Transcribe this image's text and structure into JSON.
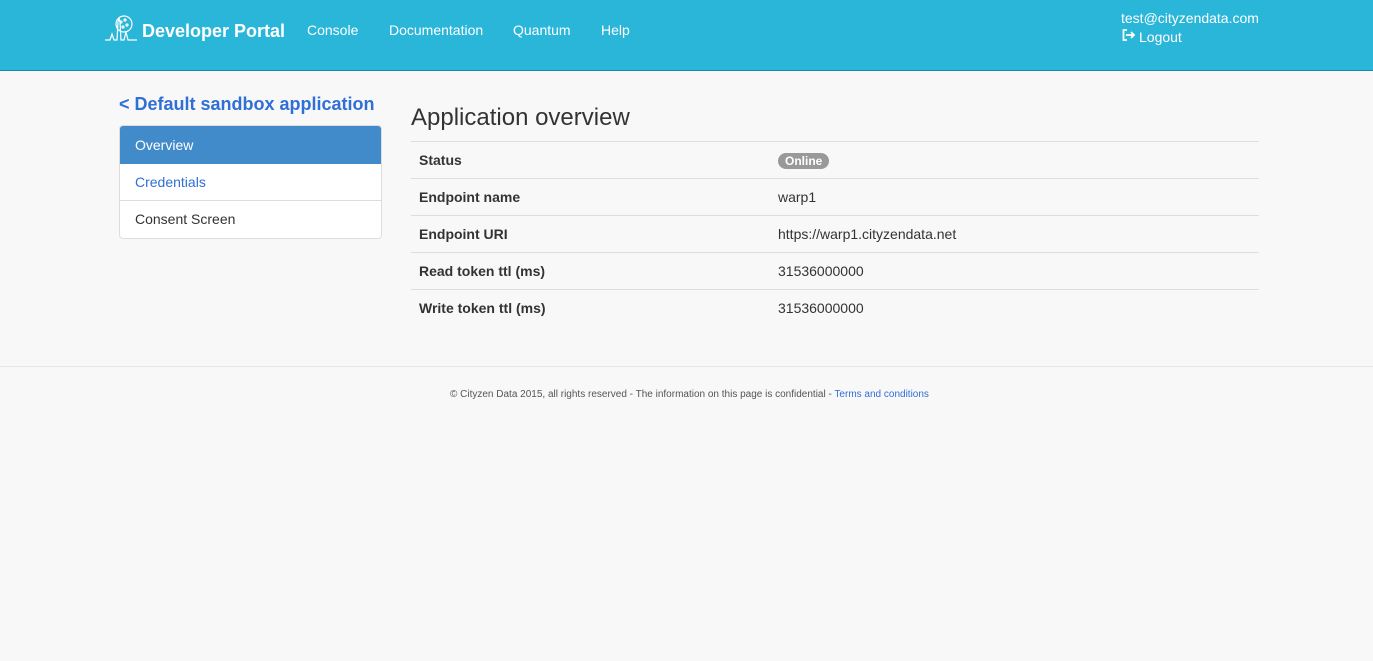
{
  "header": {
    "brand": "Developer Portal",
    "nav": [
      "Console",
      "Documentation",
      "Quantum",
      "Help"
    ],
    "user_email": "test@cityzendata.com",
    "logout_label": "Logout"
  },
  "sidebar": {
    "back_label": "< Default sandbox application",
    "items": [
      {
        "label": "Overview",
        "state": "active"
      },
      {
        "label": "Credentials",
        "state": "link"
      },
      {
        "label": "Consent Screen",
        "state": "plain"
      }
    ]
  },
  "main": {
    "title": "Application overview",
    "rows": [
      {
        "label": "Status",
        "value": "Online"
      },
      {
        "label": "Endpoint name",
        "value": "warp1"
      },
      {
        "label": "Endpoint URI",
        "value": "https://warp1.cityzendata.net"
      },
      {
        "label": "Read token ttl (ms)",
        "value": "31536000000"
      },
      {
        "label": "Write token ttl (ms)",
        "value": "31536000000"
      }
    ]
  },
  "footer": {
    "text": "© Cityzen Data 2015, all rights reserved - The information on this page is confidential - ",
    "link_label": "Terms and conditions"
  },
  "colors": {
    "header_bg": "#29b6d9",
    "active_item": "#428bca",
    "link": "#2f6fd6",
    "badge": "#999999"
  },
  "icons": {
    "brand": "waveform-logo-icon",
    "logout": "logout-icon"
  }
}
